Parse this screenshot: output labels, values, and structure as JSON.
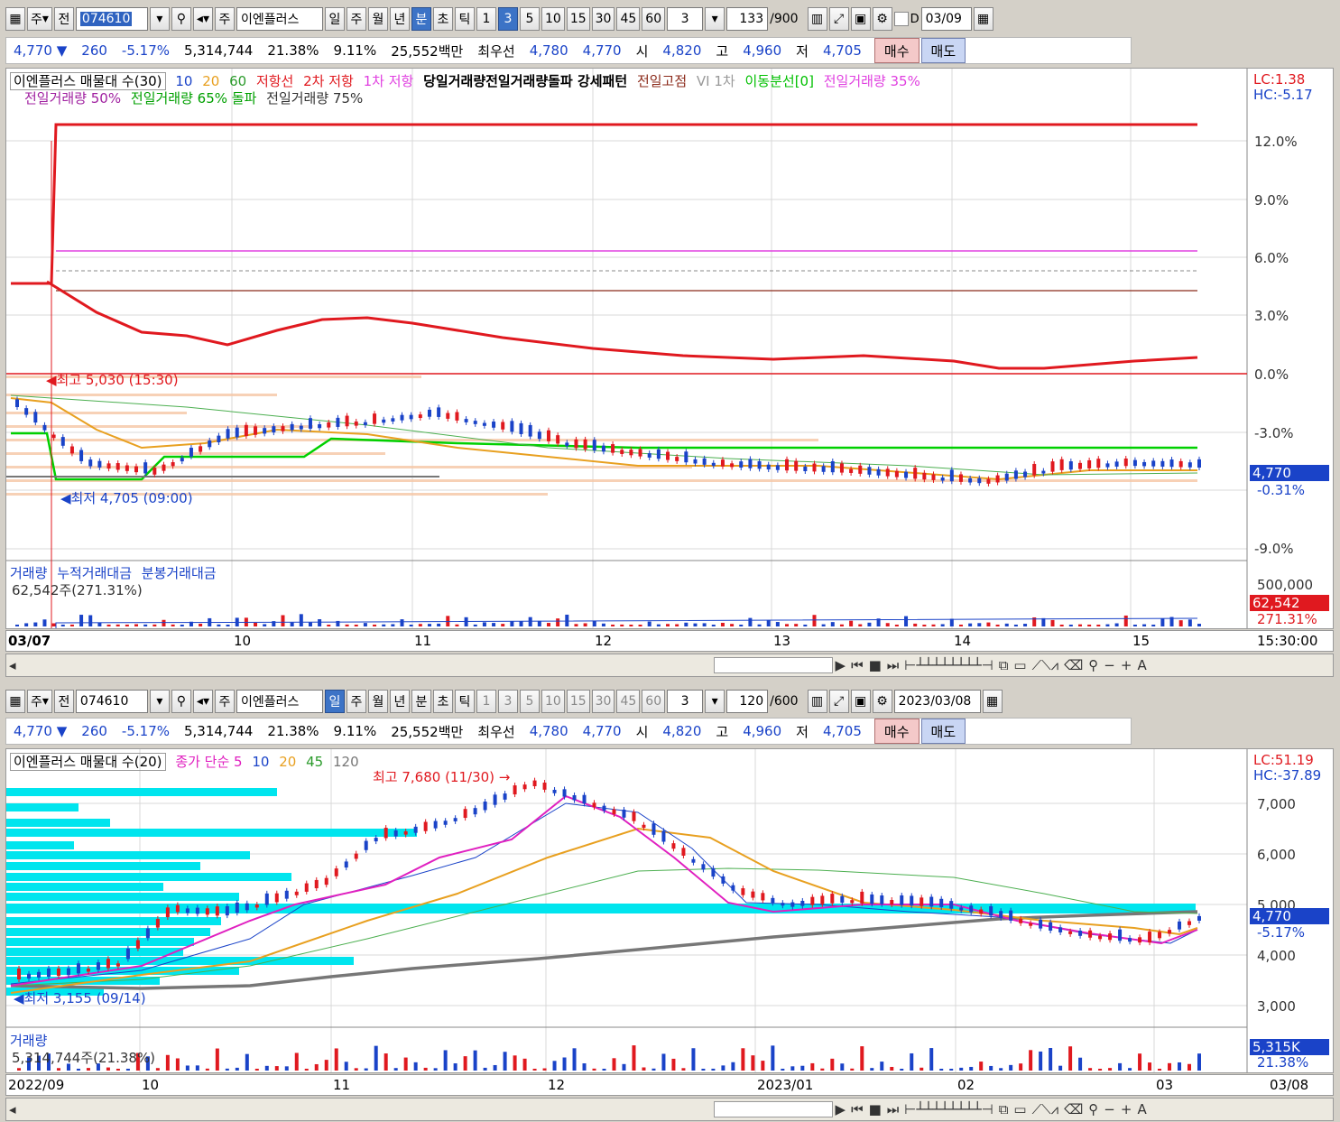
{
  "colors": {
    "up": "#e0191f",
    "down": "#1a43c8",
    "accent": "#2f63c0"
  },
  "top": {
    "toolbar": {
      "code": "074610",
      "market": "주",
      "prev": "전",
      "name": "이엔플러스",
      "periods": [
        "일",
        "주",
        "월",
        "년",
        "분",
        "초",
        "틱"
      ],
      "active_period": "분",
      "minutes": [
        "1",
        "3",
        "5",
        "10",
        "15",
        "30",
        "45",
        "60"
      ],
      "active_minute": "3",
      "unit": "3",
      "count": "133",
      "total": "/900",
      "date_label": "D",
      "date": "03/09"
    },
    "quote": {
      "price": "4,770",
      "arrow": "▼",
      "change": "260",
      "rate": "-5.17%",
      "volume": "5,314,744",
      "turnover": "21.38%",
      "rate2": "9.11%",
      "amount": "25,552백만",
      "bid_label": "최우선",
      "bid": "4,780",
      "ask": "4,770",
      "open_label": "시",
      "open": "4,820",
      "high_label": "고",
      "high": "4,960",
      "low_label": "저",
      "low": "4,705",
      "buy": "매수",
      "sell": "매도"
    },
    "legend1": [
      "이엔플러스 매물대 수(30)",
      "10",
      "20",
      "60",
      "저항선",
      "2차 저항",
      "1차 저항",
      "당일거래량전일거래량돌파 강세패턴",
      "전일고점",
      "VI 1차",
      "이동분선[0]",
      "전일거래량 35%"
    ],
    "legend2": [
      "전일거래량 50%",
      "전일거래량 65% 돌파",
      "전일거래량 75%"
    ],
    "lc": "LC:1.38",
    "hc": "HC:-5.17",
    "yticks": [
      "12.0%",
      "9.0%",
      "6.0%",
      "3.0%",
      "0.0%",
      "-3.0%",
      "-9.0%"
    ],
    "price_tag": "4,770",
    "rate_tag": "-0.31%",
    "high_note": "최고 5,030 (15:30)",
    "low_note": "최저 4,705 (09:00)",
    "vol_legend": [
      "거래량",
      "누적거래대금",
      "분봉거래대금"
    ],
    "vol_note": "62,542주(271.31%)",
    "vol_ticks": [
      "500,000"
    ],
    "vol_tag": "62,542",
    "vol_tag2": "271.31%",
    "xlabels": [
      "03/07",
      "10",
      "11",
      "12",
      "13",
      "14",
      "15"
    ],
    "time": "15:30:00"
  },
  "bottom": {
    "toolbar": {
      "code": "074610",
      "market": "주",
      "prev": "전",
      "name": "이엔플러스",
      "periods": [
        "일",
        "주",
        "월",
        "년",
        "분",
        "초",
        "틱"
      ],
      "active_period": "일",
      "minutes": [
        "1",
        "3",
        "5",
        "10",
        "15",
        "30",
        "45",
        "60"
      ],
      "unit": "3",
      "count": "120",
      "total": "/600",
      "date": "2023/03/08"
    },
    "quote": {
      "price": "4,770",
      "arrow": "▼",
      "change": "260",
      "rate": "-5.17%",
      "volume": "5,314,744",
      "turnover": "21.38%",
      "rate2": "9.11%",
      "amount": "25,552백만",
      "bid_label": "최우선",
      "bid": "4,780",
      "ask": "4,770",
      "open_label": "시",
      "open": "4,820",
      "high_label": "고",
      "high": "4,960",
      "low_label": "저",
      "low": "4,705",
      "buy": "매수",
      "sell": "매도"
    },
    "legend1": [
      "이엔플러스 매물대 수(20)",
      "종가 단순 5",
      "10",
      "20",
      "45",
      "120"
    ],
    "lc": "LC:51.19",
    "hc": "HC:-37.89",
    "yticks": [
      "7,000",
      "6,000",
      "5,000",
      "4,000",
      "3,000"
    ],
    "price_tag": "4,770",
    "rate_tag": "-5.17%",
    "high_note": "최고 7,680 (11/30)",
    "low_note": "최저 3,155 (09/14)",
    "vol_legend": [
      "거래량"
    ],
    "vol_note": "5,314,744주(21.38%)",
    "vol_tag": "5,315K",
    "vol_tag2": "21.38%",
    "xlabels": [
      "2022/09",
      "10",
      "11",
      "12",
      "2023/01",
      "02",
      "03"
    ],
    "date_end": "03/08"
  }
}
